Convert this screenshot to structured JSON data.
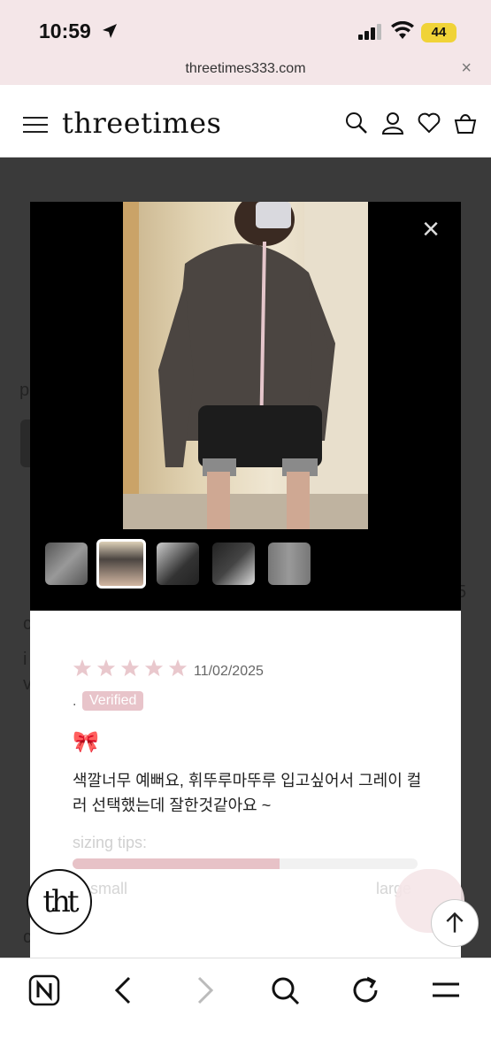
{
  "status_bar": {
    "time": "10:59",
    "battery": "44"
  },
  "browser": {
    "url": "threetimes333.com",
    "close_icon": "close-icon"
  },
  "site": {
    "brand": "threetimes"
  },
  "background": {
    "frag1": "p",
    "frag2": "c",
    "frag3": "i",
    "frag4": "v",
    "frag5": "5",
    "frag6": "c"
  },
  "review": {
    "rating": 5,
    "date": "11/02/2025",
    "author": ".",
    "verified_label": "Verified",
    "emoji": "🎀",
    "body": "색깔너무 예뻐요, 휘뚜루마뚜루 입고싶어서 그레이 컬러 선택했는데 잘한것같아요 ~",
    "sizing_label": "sizing tips:",
    "sizing_value": 0.6,
    "small_label": "small",
    "large_label": "large"
  },
  "gallery": {
    "thumb_count": 5,
    "active_index": 1
  },
  "badge": {
    "logo_text": "tht"
  },
  "colors": {
    "accent": "#e8c4ca",
    "header_bg": "#f4e6e8",
    "star": "#e9c8cd"
  }
}
